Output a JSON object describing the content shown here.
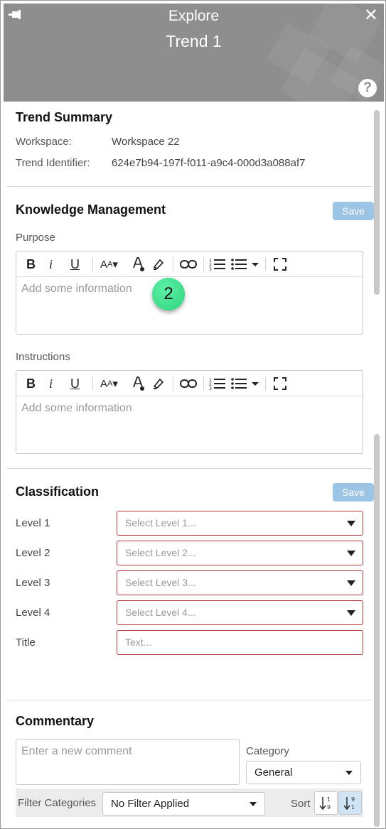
{
  "header": {
    "kicker": "Explore",
    "title": "Trend 1",
    "help": "?",
    "close": "✕",
    "bg_color": "#8e8e8e"
  },
  "trend_summary": {
    "heading": "Trend Summary",
    "workspace_label": "Workspace:",
    "workspace_value": "Workspace 22",
    "identifier_label": "Trend Identifier:",
    "identifier_value": "624e7b94-197f-f011-a9c4-000d3a088af7"
  },
  "knowledge": {
    "heading": "Knowledge Management",
    "save_label": "Save",
    "purpose_label": "Purpose",
    "purpose_placeholder": "Add some information",
    "instructions_label": "Instructions",
    "instructions_placeholder": "Add some information",
    "toolbar_icons": [
      "bold-icon",
      "italic-icon",
      "underline-icon",
      "font-size-icon",
      "font-color-icon",
      "highlight-icon",
      "link-icon",
      "ordered-list-icon",
      "unordered-list-icon",
      "fullscreen-icon"
    ]
  },
  "badge": {
    "text": "2",
    "color": "#2bd47c"
  },
  "classification": {
    "heading": "Classification",
    "save_label": "Save",
    "levels": [
      {
        "label": "Level 1",
        "placeholder": "Select Level 1..."
      },
      {
        "label": "Level 2",
        "placeholder": "Select Level 2..."
      },
      {
        "label": "Level 3",
        "placeholder": "Select Level 3..."
      },
      {
        "label": "Level 4",
        "placeholder": "Select Level 4..."
      }
    ],
    "title_label": "Title",
    "title_placeholder": "Text...",
    "error_border_color": "#b33a3a"
  },
  "commentary": {
    "heading": "Commentary",
    "comment_placeholder": "Enter a new comment",
    "category_label": "Category",
    "category_value": "General",
    "filter_label": "Filter Categories",
    "filter_value": "No Filter Applied",
    "sort_label": "Sort",
    "sort_options": [
      {
        "icon": "sort-ascending-icon",
        "top": "1",
        "bottom": "9"
      },
      {
        "icon": "sort-descending-icon",
        "top": "9",
        "bottom": "1"
      }
    ]
  },
  "accent_color": "#9cc4e4"
}
